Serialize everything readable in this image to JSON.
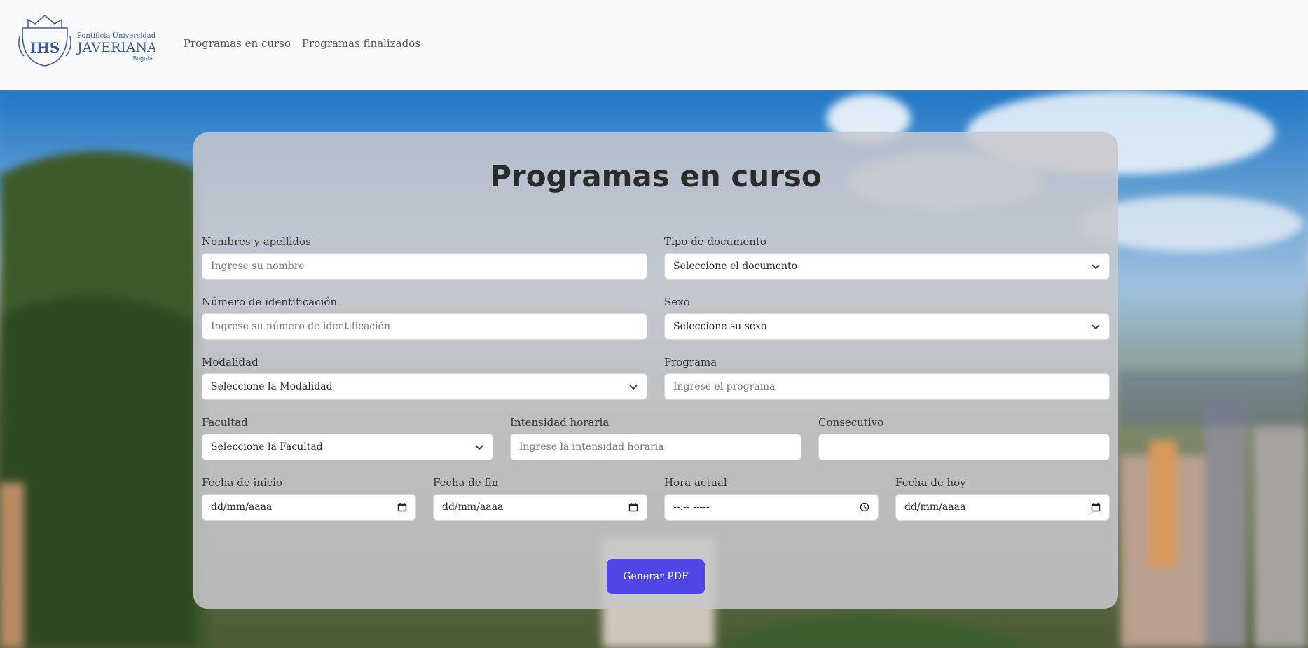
{
  "brand": {
    "line1": "Pontificia Universidad",
    "line2": "JAVERIANA",
    "line3": "Bogotá",
    "monogram": "IHS"
  },
  "nav": {
    "items": [
      {
        "label": "Programas en curso"
      },
      {
        "label": "Programas finalizados"
      }
    ]
  },
  "form": {
    "title": "Programas en curso",
    "fields": {
      "nombres": {
        "label": "Nombres y apellidos",
        "placeholder": "Ingrese su nombre"
      },
      "tipo_documento": {
        "label": "Tipo de documento",
        "value": "Seleccione el documento"
      },
      "numero_id": {
        "label": "Número de identificación",
        "placeholder": "Ingrese su número de identificación"
      },
      "sexo": {
        "label": "Sexo",
        "value": "Seleccione su sexo"
      },
      "modalidad": {
        "label": "Modalidad",
        "value": "Seleccione la Modalidad"
      },
      "programa": {
        "label": "Programa",
        "placeholder": "Ingrese el programa"
      },
      "facultad": {
        "label": "Facultad",
        "value": "Seleccione la Facultad"
      },
      "intensidad": {
        "label": "Intensidad horaria",
        "placeholder": "Ingrese la intensidad horaria"
      },
      "consecutivo": {
        "label": "Consecutivo",
        "value": ""
      },
      "fecha_inicio": {
        "label": "Fecha de inicio",
        "value": "dd/mm/aaaa"
      },
      "fecha_fin": {
        "label": "Fecha de fin",
        "value": "dd/mm/aaaa"
      },
      "hora_actual": {
        "label": "Hora actual",
        "value": "--:-- -----"
      },
      "fecha_hoy": {
        "label": "Fecha de hoy",
        "value": "dd/mm/aaaa"
      }
    },
    "submit_label": "Generar PDF"
  },
  "colors": {
    "primary_button": "#5046e5",
    "navbar_bg": "#f8f9fa",
    "logo_blue": "#3a5a9c"
  }
}
